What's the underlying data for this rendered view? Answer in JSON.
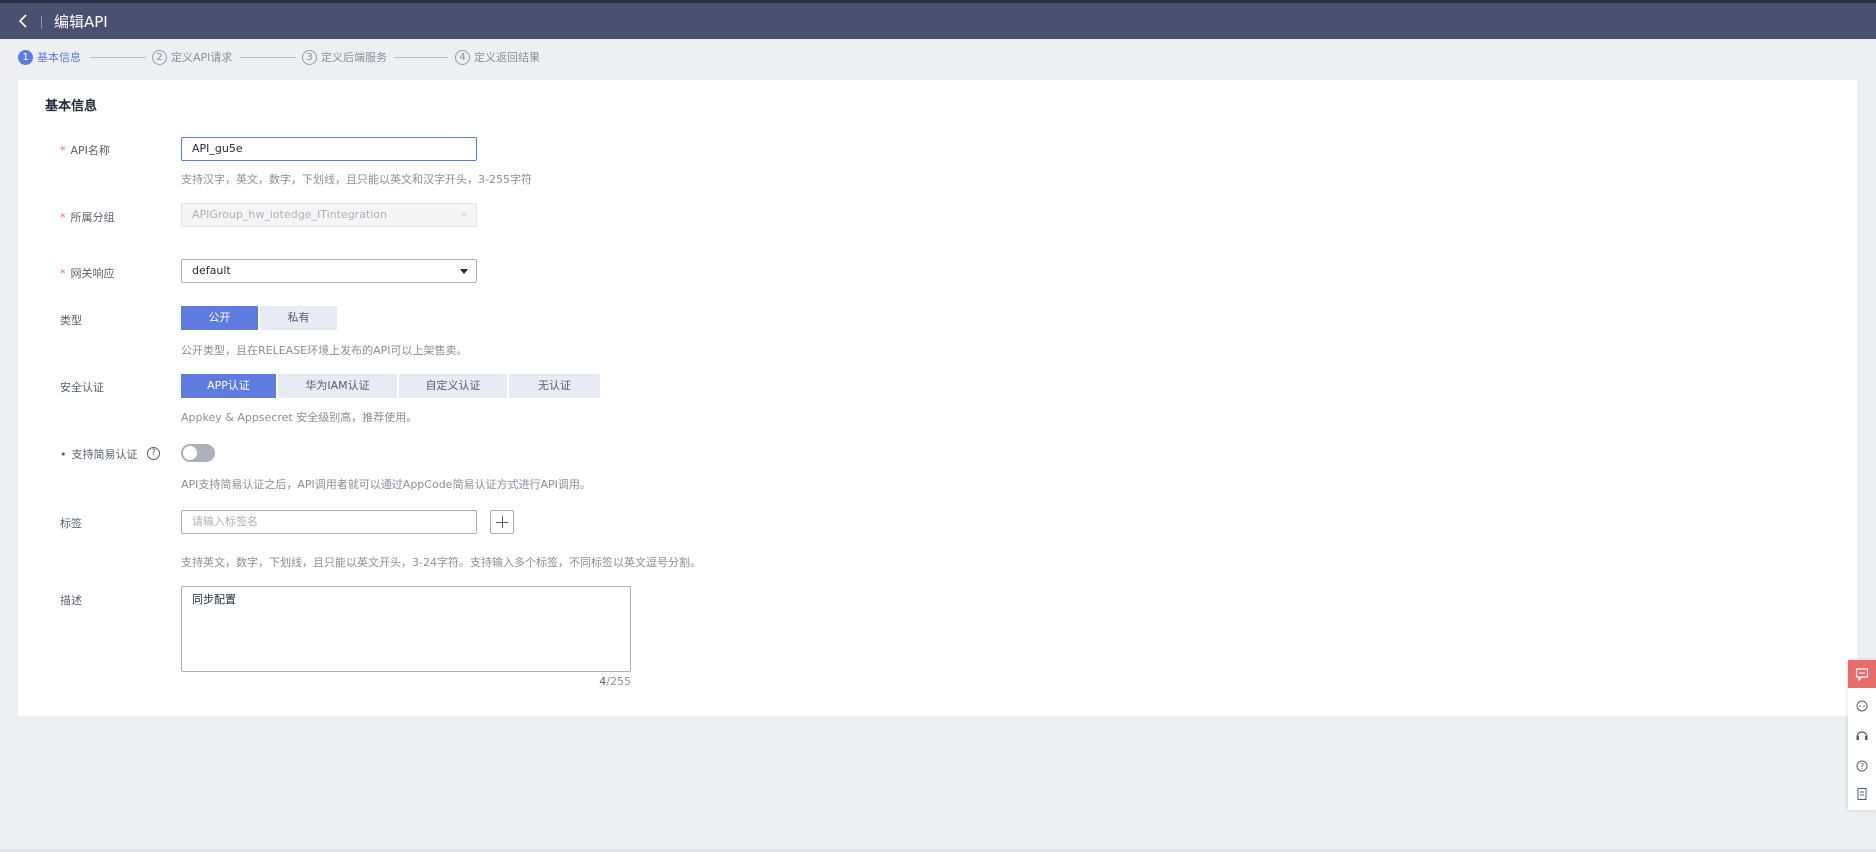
{
  "header": {
    "title": "编辑API"
  },
  "steps": [
    {
      "num": "1",
      "label": "基本信息"
    },
    {
      "num": "2",
      "label": "定义API请求"
    },
    {
      "num": "3",
      "label": "定义后端服务"
    },
    {
      "num": "4",
      "label": "定义返回结果"
    }
  ],
  "form": {
    "section_title": "基本信息",
    "required_mark": "*",
    "api_name": {
      "label": "API名称",
      "value": "API_gu5e",
      "hint": "支持汉字，英文，数字，下划线，且只能以英文和汉字开头，3-255字符"
    },
    "group": {
      "label": "所属分组",
      "value": "APIGroup_hw_iotedge_ITintegration"
    },
    "gateway_response": {
      "label": "网关响应",
      "value": "default"
    },
    "type": {
      "label": "类型",
      "options": [
        "公开",
        "私有"
      ],
      "selected": "公开",
      "hint": "公开类型，且在RELEASE环境上发布的API可以上架售卖。"
    },
    "auth": {
      "label": "安全认证",
      "options": [
        "APP认证",
        "华为IAM认证",
        "自定义认证",
        "无认证"
      ],
      "selected": "APP认证",
      "hint": "Appkey & Appsecret 安全级别高，推荐使用。"
    },
    "simple_auth": {
      "label": "支持简易认证",
      "help": "?",
      "enabled": false,
      "hint": "API支持简易认证之后，API调用者就可以通过AppCode简易认证方式进行API调用。"
    },
    "tags": {
      "label": "标签",
      "placeholder": "请输入标签名",
      "hint": "支持英文，数字，下划线，且只能以英文开头，3-24字符。支持输入多个标签，不同标签以英文逗号分割。"
    },
    "description": {
      "label": "描述",
      "value": "同步配置",
      "count": "4",
      "max": "/255"
    }
  },
  "colors": {
    "accent": "#5e7ce0",
    "header": "#4b5070",
    "required": "#f66f6a",
    "feedback": "#e76d6a"
  },
  "floating_tools": [
    "feedback-icon",
    "chat-robot-icon",
    "customer-service-icon",
    "help-icon",
    "notes-icon"
  ]
}
